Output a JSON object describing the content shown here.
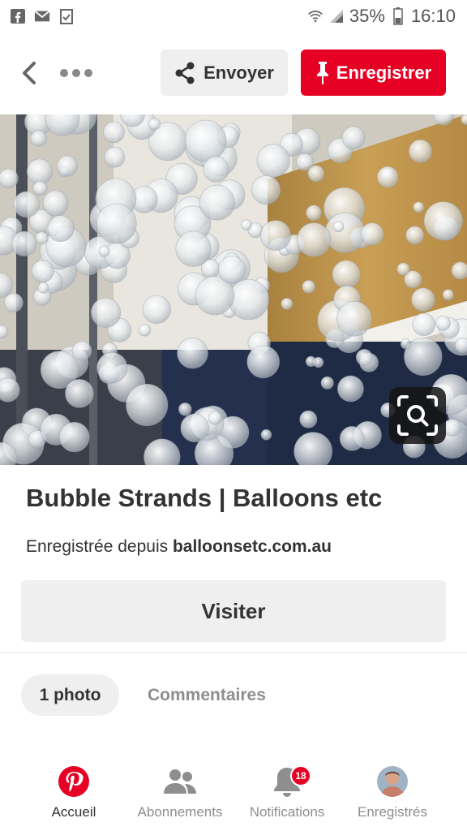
{
  "status_bar": {
    "battery": "35%",
    "time": "16:10",
    "left_icons": [
      "facebook-icon",
      "mail-icon",
      "clipboard-check-icon"
    ],
    "right_icons": [
      "wifi-icon",
      "signal-icon",
      "battery-icon"
    ]
  },
  "action_bar": {
    "share_label": "Envoyer",
    "save_label": "Enregistrer"
  },
  "pin": {
    "title": "Bubble Strands | Balloons etc",
    "saved_from_prefix": "Enregistrée depuis ",
    "saved_from_domain": "balloonsetc.com.au",
    "visit_label": "Visiter"
  },
  "tabs": {
    "photo_label": "1 photo",
    "comments_label": "Commentaires"
  },
  "bottom_nav": {
    "home_label": "Accueil",
    "following_label": "Abonnements",
    "notifications_label": "Notifications",
    "notifications_badge": "18",
    "saved_label": "Enregistrés"
  },
  "colors": {
    "brand_red": "#e60023",
    "button_gray": "#efefef",
    "text_dark": "#333333",
    "text_muted": "#8e8e8e"
  }
}
